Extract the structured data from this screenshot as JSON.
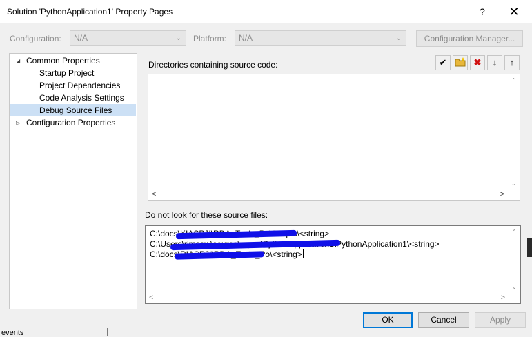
{
  "window": {
    "title": "Solution 'PythonApplication1' Property Pages",
    "help_glyph": "?",
    "close_glyph": "✕"
  },
  "toolbar": {
    "configuration_label": "Configuration:",
    "configuration_value": "N/A",
    "platform_label": "Platform:",
    "platform_value": "N/A",
    "config_manager_label": "Configuration Manager..."
  },
  "tree": {
    "items": [
      {
        "label": "Common Properties",
        "expander": "◢",
        "expanded": true
      },
      {
        "label": "Startup Project"
      },
      {
        "label": "Project Dependencies"
      },
      {
        "label": "Code Analysis Settings"
      },
      {
        "label": "Debug Source Files",
        "selected": true
      },
      {
        "label": "Configuration Properties",
        "expander": "▷",
        "expanded": false
      }
    ]
  },
  "source_dirs": {
    "label": "Directories containing source code:",
    "tools": [
      {
        "name": "check-icon",
        "glyph": "✔",
        "color": "#000000"
      },
      {
        "name": "new-folder-icon",
        "glyph": "📁",
        "color": "#d8a000"
      },
      {
        "name": "delete-icon",
        "glyph": "✖",
        "color": "#d01010"
      },
      {
        "name": "move-down-icon",
        "glyph": "🡓",
        "color": "#000000"
      },
      {
        "name": "move-up-icon",
        "glyph": "🡑",
        "color": "#000000"
      }
    ],
    "entries": []
  },
  "exclude": {
    "label": "Do not look for these source files:",
    "lines": [
      "C:\\docs\\KIASPJI\\RDA_Tools_Po\\Scripts\\<string>",
      "C:\\Users\\rimsow\\source\\repos\\PythonApplication1\\PythonApplication1\\<string>",
      "C:\\docs\\RIASPJI\\RDA_Tools_Po\\<string>"
    ]
  },
  "buttons": {
    "ok": "OK",
    "cancel": "Cancel",
    "apply": "Apply"
  },
  "colors": {
    "accent": "#0078d7",
    "selection": "#cce0f5",
    "redaction": "#1010e8"
  },
  "background_leak_text": "events"
}
